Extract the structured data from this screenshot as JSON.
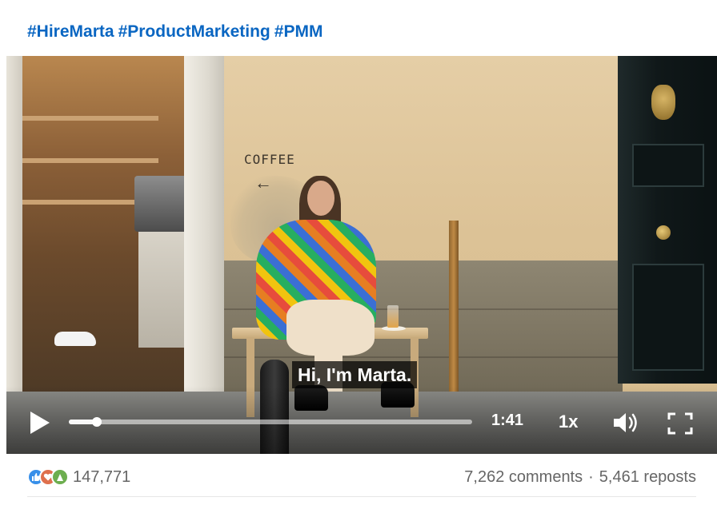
{
  "post": {
    "hashtags": [
      "#HireMarta",
      "#ProductMarketing",
      "#PMM"
    ]
  },
  "video": {
    "scene_text": {
      "coffee_sign": "COFFEE",
      "coffee_arrow": "←"
    },
    "caption": "Hi, I'm Marta.",
    "controls": {
      "play_icon": "play-icon",
      "progress_fraction": 0.07,
      "time": "1:41",
      "speed": "1x",
      "volume_icon": "volume-icon",
      "fullscreen_icon": "fullscreen-icon"
    }
  },
  "social": {
    "reaction_icons": [
      "like-icon",
      "love-icon",
      "support-icon"
    ],
    "reaction_colors": [
      "#378fe9",
      "#df704d",
      "#6dae4f"
    ],
    "reaction_count": "147,771",
    "comments": "7,262 comments",
    "separator": "·",
    "reposts": "5,461 reposts"
  }
}
